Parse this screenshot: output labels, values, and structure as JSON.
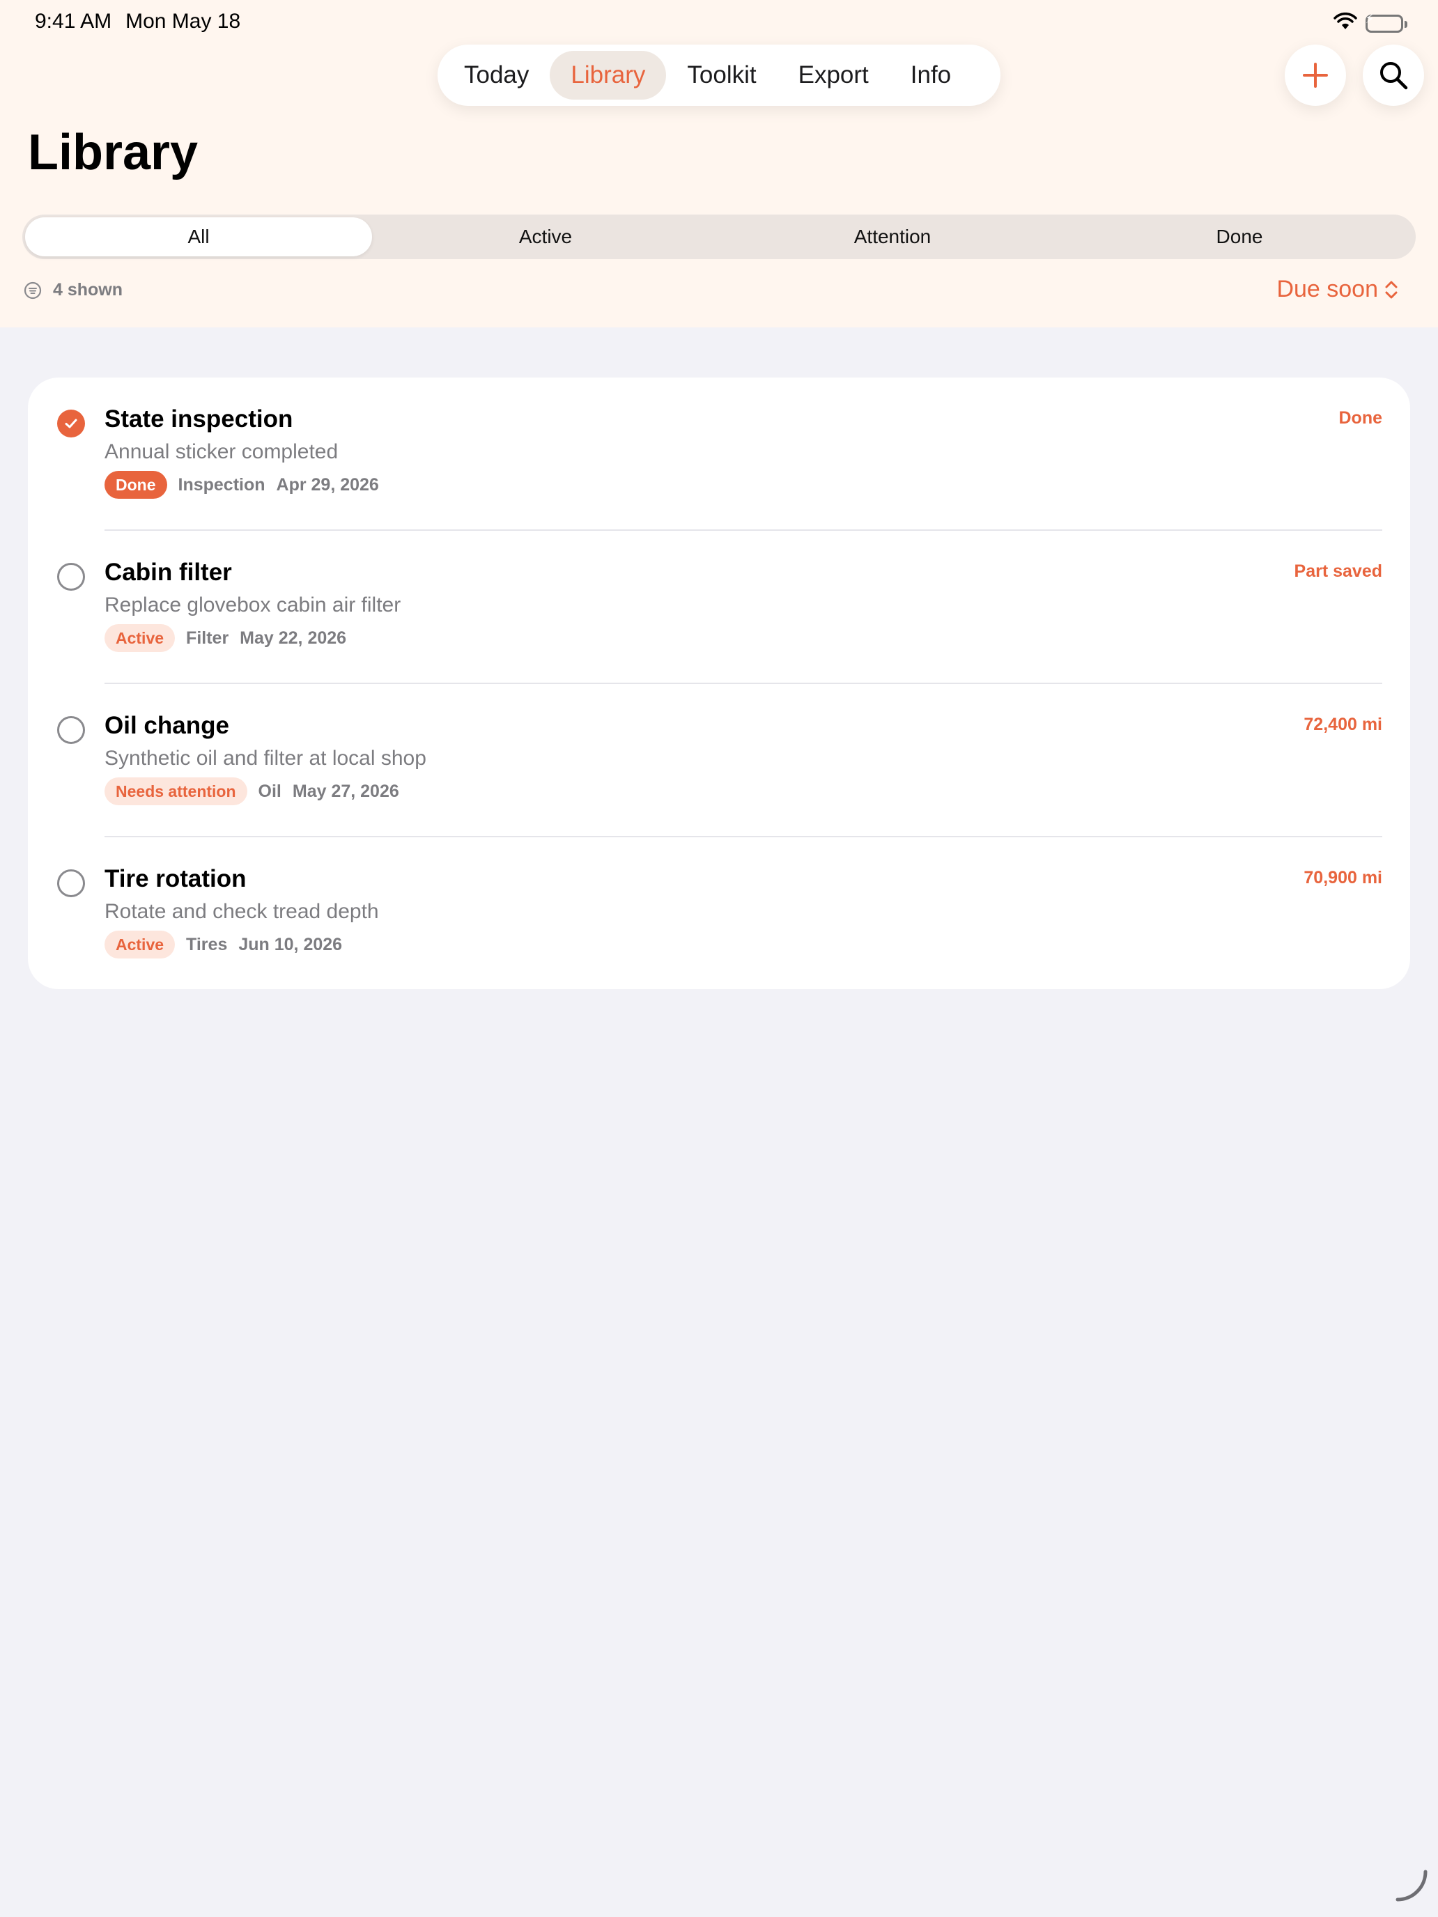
{
  "status_bar": {
    "time": "9:41 AM",
    "date": "Mon May 18"
  },
  "nav": {
    "tabs": [
      {
        "label": "Today",
        "active": false
      },
      {
        "label": "Library",
        "active": true
      },
      {
        "label": "Toolkit",
        "active": false
      },
      {
        "label": "Export",
        "active": false
      },
      {
        "label": "Info",
        "active": false
      }
    ]
  },
  "page": {
    "title": "Library"
  },
  "filters": {
    "segments": [
      {
        "label": "All",
        "active": true
      },
      {
        "label": "Active",
        "active": false
      },
      {
        "label": "Attention",
        "active": false
      },
      {
        "label": "Done",
        "active": false
      }
    ],
    "count_label": "4 shown",
    "sort_label": "Due soon"
  },
  "items": [
    {
      "title": "State inspection",
      "subtitle": "Annual sticker completed",
      "status": "Done",
      "category": "Inspection",
      "date": "Apr 29, 2026",
      "right_label": "Done",
      "checked": true
    },
    {
      "title": "Cabin filter",
      "subtitle": "Replace glovebox cabin air filter",
      "status": "Active",
      "category": "Filter",
      "date": "May 22, 2026",
      "right_label": "Part saved",
      "checked": false
    },
    {
      "title": "Oil change",
      "subtitle": "Synthetic oil and filter at local shop",
      "status": "Needs attention",
      "category": "Oil",
      "date": "May 27, 2026",
      "right_label": "72,400 mi",
      "checked": false
    },
    {
      "title": "Tire rotation",
      "subtitle": "Rotate and check tread depth",
      "status": "Active",
      "category": "Tires",
      "date": "Jun 10, 2026",
      "right_label": "70,900 mi",
      "checked": false
    }
  ],
  "colors": {
    "accent": "#e8643d",
    "header_bg": "#fff6ef",
    "page_bg": "#f2f2f7",
    "badge_bg": "#fde6dd"
  }
}
